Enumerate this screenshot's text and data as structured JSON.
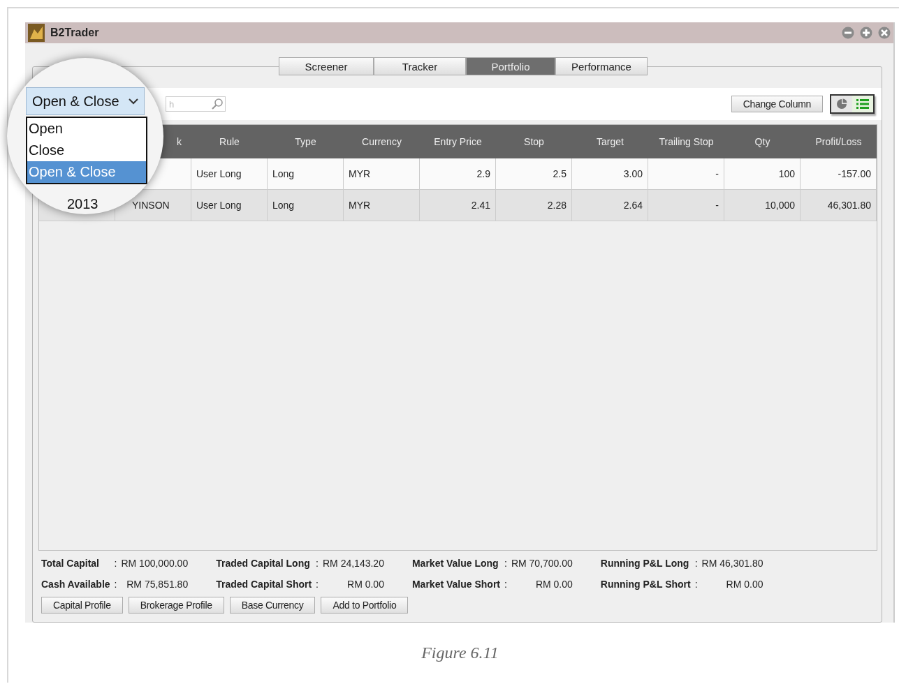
{
  "window": {
    "title": "B2Trader"
  },
  "tabs": [
    {
      "label": "Screener",
      "selected": false
    },
    {
      "label": "Tracker",
      "selected": false
    },
    {
      "label": "Portfolio",
      "selected": true
    },
    {
      "label": "Performance",
      "selected": false
    }
  ],
  "toolbar": {
    "search": {
      "placeholder": "h"
    },
    "change_column_button": "Change Column",
    "view_toggle": {
      "chart_selected": false,
      "list_selected": true
    }
  },
  "magnifier": {
    "select": {
      "value": "Open & Close"
    },
    "options": [
      {
        "label": "Open",
        "selected": false
      },
      {
        "label": "Close",
        "selected": false
      },
      {
        "label": "Open & Close",
        "selected": true
      }
    ],
    "date_fragment": "2013"
  },
  "table": {
    "columns": [
      {
        "kind": "text"
      },
      {
        "label": "k",
        "kind": "clipped"
      },
      {
        "label": "Rule",
        "kind": "text"
      },
      {
        "label": "Type",
        "kind": "text"
      },
      {
        "label": "Currency",
        "kind": "text"
      },
      {
        "label": "Entry Price",
        "kind": "number"
      },
      {
        "label": "Stop",
        "kind": "number"
      },
      {
        "label": "Target",
        "kind": "number"
      },
      {
        "label": "Trailing Stop",
        "kind": "number"
      },
      {
        "label": "Qty",
        "kind": "number"
      },
      {
        "label": "Profit/Loss",
        "kind": "number"
      }
    ],
    "rows": [
      [
        "",
        "",
        "User Long",
        "Long",
        "MYR",
        "2.9",
        "2.5",
        "3.00",
        "-",
        "100",
        "-157.00"
      ],
      [
        "",
        "YINSON",
        "User Long",
        "Long",
        "MYR",
        "2.41",
        "2.28",
        "2.64",
        "-",
        "10,000",
        "46,301.80"
      ]
    ]
  },
  "summary": [
    [
      {
        "label": "Total Capital",
        "sep": ":",
        "value": "RM 100,000.00"
      },
      {
        "label": "Cash Available",
        "sep": ":",
        "value": "RM 75,851.80"
      }
    ],
    [
      {
        "label": "Traded Capital Long",
        "sep": ":",
        "value": "RM 24,143.20"
      },
      {
        "label": "Traded Capital Short",
        "sep": ":",
        "value": "RM 0.00"
      }
    ],
    [
      {
        "label": "Market Value Long",
        "sep": ":",
        "value": "RM 70,700.00"
      },
      {
        "label": "Market Value Short",
        "sep": ":",
        "value": "RM 0.00"
      }
    ],
    [
      {
        "label": "Running P&L Long",
        "sep": ":",
        "value": "RM 46,301.80"
      },
      {
        "label": "Running P&L Short",
        "sep": ":",
        "value": "RM 0.00"
      }
    ]
  ],
  "buttons": [
    "Capital Profile",
    "Brokerage Profile",
    "Base Currency",
    "Add to Portfolio"
  ],
  "caption": "Figure 6.11"
}
